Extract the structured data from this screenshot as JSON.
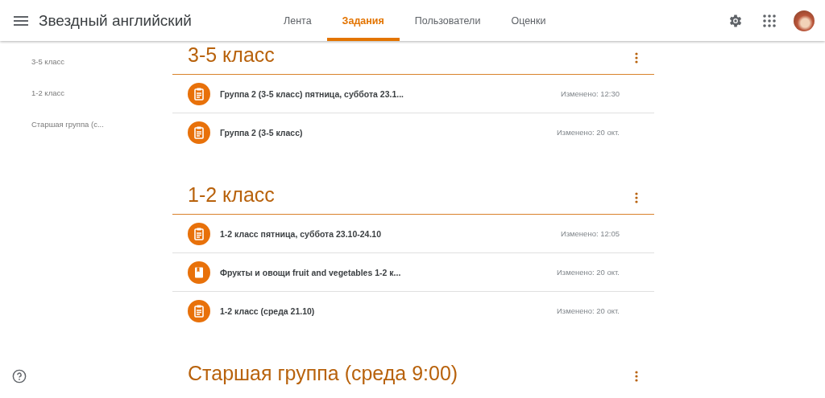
{
  "header": {
    "title": "Звездный английский",
    "tabs": [
      {
        "label": "Лента",
        "selected": false
      },
      {
        "label": "Задания",
        "selected": true
      },
      {
        "label": "Пользователи",
        "selected": false
      },
      {
        "label": "Оценки",
        "selected": false
      }
    ]
  },
  "sidebar": {
    "items": [
      "3-5 класс",
      "1-2 класс",
      "Старшая группа (с..."
    ]
  },
  "sections": [
    {
      "title": "3-5 класс",
      "items": [
        {
          "kind": "assignment",
          "title": "Группа 2 (3-5 класс) пятница, суббота 23.1...",
          "modified": "Изменено: 12:30"
        },
        {
          "kind": "assignment",
          "title": "Группа 2 (3-5 класс)",
          "modified": "Изменено: 20 окт."
        }
      ]
    },
    {
      "title": "1-2 класс",
      "items": [
        {
          "kind": "assignment",
          "title": "1-2 класс пятница, суббота 23.10-24.10",
          "modified": "Изменено: 12:05"
        },
        {
          "kind": "material",
          "title": "Фрукты и овощи fruit and vegetables 1-2 к...",
          "modified": "Изменено: 20 окт."
        },
        {
          "kind": "assignment",
          "title": "1-2 класс (среда 21.10)",
          "modified": "Изменено: 20 окт."
        }
      ]
    },
    {
      "title": "Старшая группа (среда 9:00)"
    }
  ]
}
